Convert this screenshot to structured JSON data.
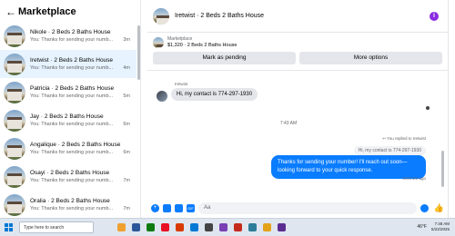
{
  "left": {
    "title": "Marketplace",
    "conversations": [
      {
        "name": "Nikole · 2 Beds 2 Baths House",
        "preview": "You: Thanks for sending your numb...",
        "time": "3m"
      },
      {
        "name": "Iretwist · 2 Beds 2 Baths House",
        "preview": "You: Thanks for sending your numb...",
        "time": "4m"
      },
      {
        "name": "Patricia · 2 Beds 2 Baths House",
        "preview": "You: Thanks for sending your numb...",
        "time": "5m"
      },
      {
        "name": "Jay · 2 Beds 2 Baths House",
        "preview": "You: Thanks for sending your numb...",
        "time": "6m"
      },
      {
        "name": "Angalique · 2 Beds 2 Baths House",
        "preview": "You: Thanks for sending your numb...",
        "time": "6m"
      },
      {
        "name": "Osayi · 2 Beds 2 Baths House",
        "preview": "You: Thanks for sending your numb...",
        "time": "7m"
      },
      {
        "name": "Oralia · 2 Beds 2 Baths House",
        "preview": "You: Thanks for sending your numb...",
        "time": "7m"
      }
    ]
  },
  "chat": {
    "title": "Iretwist · 2 Beds 2 Baths House",
    "listing_category": "Marketplace",
    "listing_price": "$1,320 · 2 Beds 2 Baths House",
    "mark_pending": "Mark as pending",
    "more_options": "More options",
    "sender_label": "Iretwist",
    "incoming": "Hi, my contact is 774-297-1930",
    "time_separator": "7:43 AM",
    "replied_label": "You replied to Iretwist",
    "quoted": "Hi, my contact is 774-297-1930",
    "outgoing": "Thanks for sending your number! I'll reach out soon—looking forward to your quick response.",
    "sent_label": "Sent 4m ago",
    "composer_placeholder": "Aa"
  },
  "taskbar": {
    "search_placeholder": "Type here to search",
    "temperature": "46°F",
    "time": "7:48 AM",
    "date": "5/22/2025",
    "app_colors": [
      "#f0a030",
      "#2b579a",
      "#0f7b0f",
      "#e81123",
      "#d83b01",
      "#0078d4",
      "#444444",
      "#7a3fb5",
      "#c42b1c",
      "#2d7d9a",
      "#e3a21a",
      "#5c2d91"
    ]
  }
}
